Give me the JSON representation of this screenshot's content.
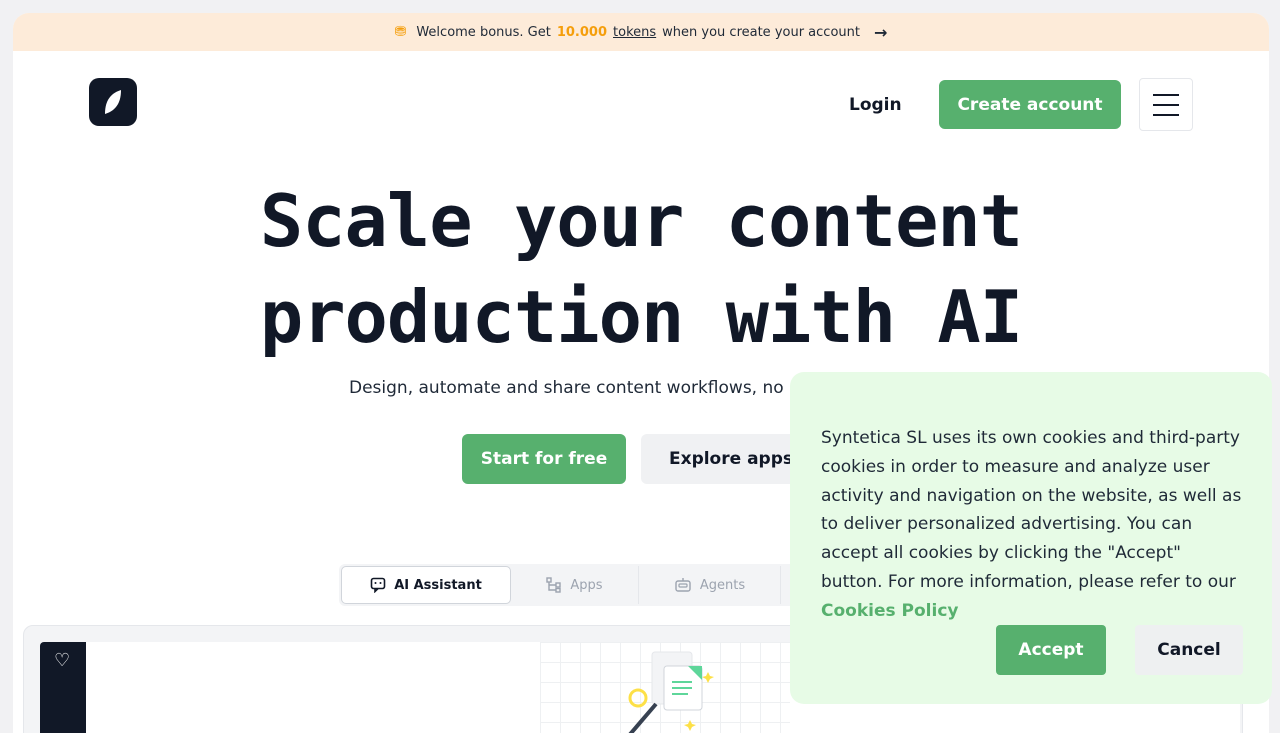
{
  "promo": {
    "prefix": "Welcome bonus. Get",
    "amount": "10.000",
    "tokens": "tokens",
    "suffix": "when you create your account",
    "arrow": "→"
  },
  "header": {
    "login": "Login",
    "create_account": "Create account"
  },
  "hero": {
    "line1": "Scale your content",
    "line2": "production with AI",
    "subtitle": "Design, automate and share content workflows, no",
    "start": "Start for free",
    "explore": "Explore apps"
  },
  "tabs": [
    {
      "label": "AI Assistant",
      "icon": "chat-icon"
    },
    {
      "label": "Apps",
      "icon": "flow-icon"
    },
    {
      "label": "Agents",
      "icon": "robot-icon"
    }
  ],
  "cookie": {
    "text": "Syntetica SL uses its own cookies and third-party cookies in order to measure and analyze user activity and navigation on the website, as well as to deliver personalized advertising. You can accept all cookies by clicking the \"Accept\" button. For more information, please refer to our",
    "policy_link": "Cookies Policy",
    "accept": "Accept",
    "cancel": "Cancel"
  },
  "colors": {
    "accent": "#57b06e",
    "promo_bg": "#fdebd9",
    "cookie_bg": "#e7fbe6",
    "dark": "#111827"
  }
}
